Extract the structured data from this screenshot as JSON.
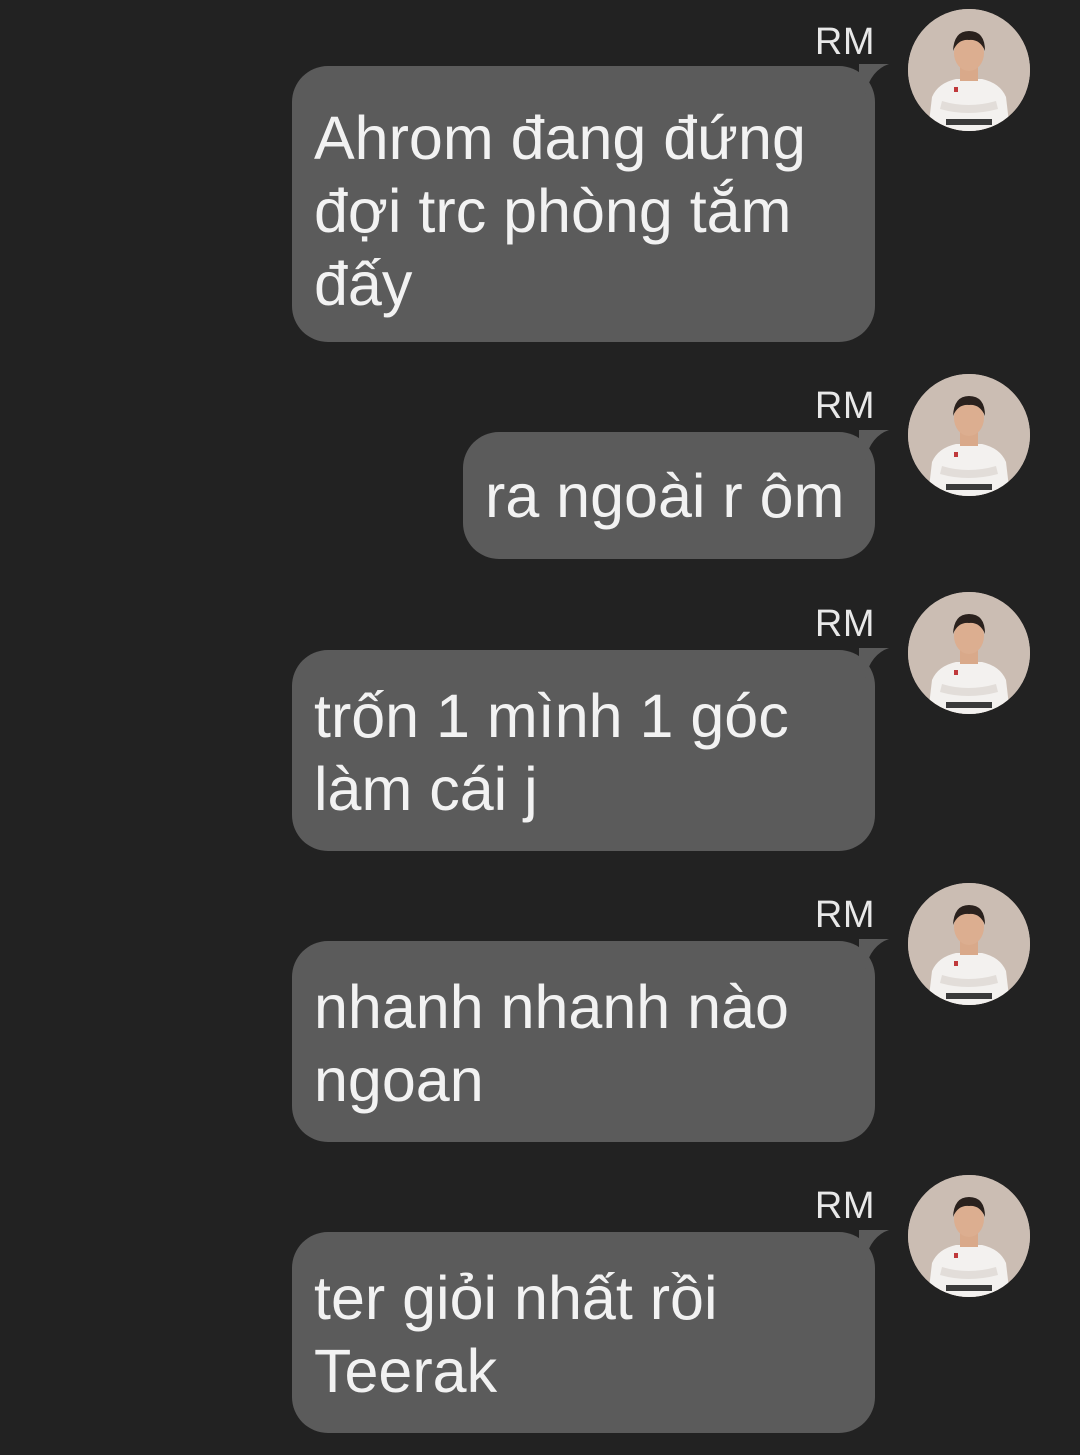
{
  "messages": [
    {
      "sender": "RM",
      "text": "Ahrom đang đứng đợi trc phòng tắm đấy",
      "avatar": "person-photo-avatar"
    },
    {
      "sender": "RM",
      "text": "ra ngoài r ôm",
      "avatar": "person-photo-avatar"
    },
    {
      "sender": "RM",
      "text": "trốn 1 mình 1 góc làm cái j",
      "avatar": "person-photo-avatar"
    },
    {
      "sender": "RM",
      "text": "nhanh nhanh nào ngoan",
      "avatar": "person-photo-avatar"
    },
    {
      "sender": "RM",
      "text": "ter giỏi nhất rồi Teerak",
      "avatar": "person-photo-avatar"
    }
  ],
  "colors": {
    "background": "#222222",
    "bubble": "#5b5b5b",
    "text": "#f2f2f2"
  }
}
